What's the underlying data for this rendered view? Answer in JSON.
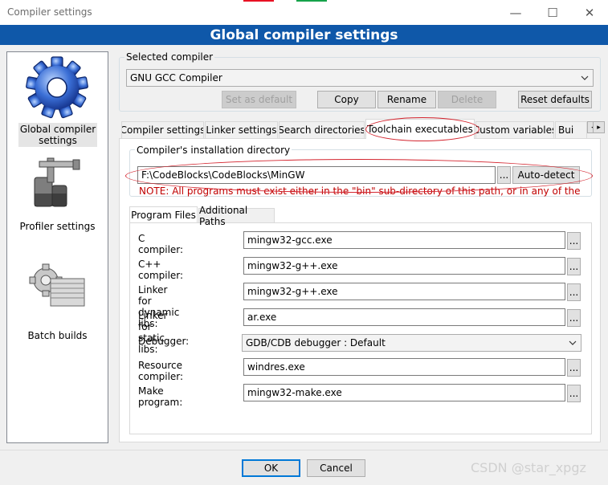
{
  "window": {
    "title": "Compiler settings",
    "controls": {
      "minimize": "—",
      "maximize": "☐",
      "close": "✕"
    }
  },
  "header": {
    "title": "Global compiler settings"
  },
  "sidebar": {
    "items": [
      {
        "label": "Global compiler settings",
        "icon": "gear-icon"
      },
      {
        "label": "Profiler settings",
        "icon": "profiler-icon"
      },
      {
        "label": "Batch builds",
        "icon": "batch-builds-icon"
      }
    ]
  },
  "selected_compiler": {
    "group_label": "Selected compiler",
    "value": "GNU GCC Compiler",
    "buttons": {
      "set_default": "Set as default",
      "copy": "Copy",
      "rename": "Rename",
      "delete": "Delete",
      "reset_defaults": "Reset defaults"
    }
  },
  "tabs": [
    {
      "label": "Compiler settings"
    },
    {
      "label": "Linker settings"
    },
    {
      "label": "Search directories"
    },
    {
      "label": "Toolchain executables"
    },
    {
      "label": "Custom variables"
    },
    {
      "label": "Bui"
    }
  ],
  "tab_scroll": {
    "left": "◂",
    "right": "▸"
  },
  "install_dir": {
    "group_label": "Compiler's installation directory",
    "value": "F:\\CodeBlocks\\CodeBlocks\\MinGW",
    "browse": "...",
    "autodetect": "Auto-detect",
    "note": "NOTE: All programs must exist either in the \"bin\" sub-directory of this path, or in any of the"
  },
  "subtabs": [
    {
      "label": "Program Files"
    },
    {
      "label": "Additional Paths"
    }
  ],
  "programs": {
    "c_compiler": {
      "label": "C compiler:",
      "value": "mingw32-gcc.exe"
    },
    "cpp_compiler": {
      "label": "C++ compiler:",
      "value": "mingw32-g++.exe"
    },
    "linker_dynamic": {
      "label": "Linker for dynamic libs:",
      "value": "mingw32-g++.exe"
    },
    "linker_static": {
      "label": "Linker for static libs:",
      "value": "ar.exe"
    },
    "debugger": {
      "label": "Debugger:",
      "value": "GDB/CDB debugger : Default"
    },
    "resource_compiler": {
      "label": "Resource compiler:",
      "value": "windres.exe"
    },
    "make_program": {
      "label": "Make program:",
      "value": "mingw32-make.exe"
    },
    "browse": "..."
  },
  "footer": {
    "ok": "OK",
    "cancel": "Cancel"
  },
  "watermark": "CSDN @star_xpgz",
  "colors": {
    "header": "#0f58a9",
    "annotation": "#d4252f",
    "note": "#c00000"
  }
}
